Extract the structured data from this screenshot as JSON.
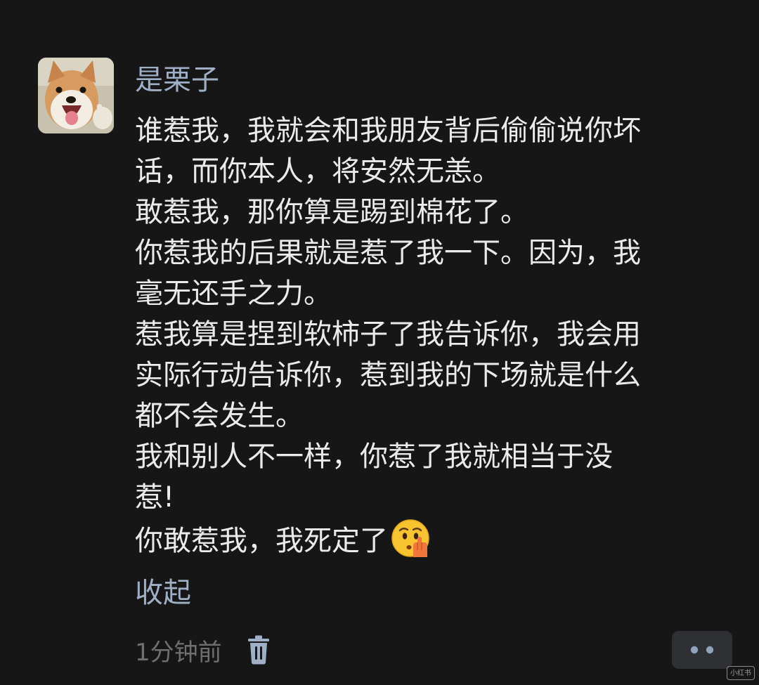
{
  "comment": {
    "author": "是栗子",
    "avatar_icon": "shiba-dog-avatar",
    "lines": [
      "谁惹我，我就会和我朋友背后偷偷说你坏",
      "话，而你本人，将安然无恙。",
      "敢惹我，那你算是踢到棉花了。",
      "你惹我的后果就是惹了我一下。因为，我",
      "毫无还手之力。",
      "惹我算是捏到软柿子了我告诉你，我会用",
      "实际行动告诉你，惹到我的下场就是什么",
      "都不会发生。",
      "我和别人不一样，你惹了我就相当于没",
      "惹!",
      "你敢惹我，我死定了"
    ],
    "last_line_emoji": "shushing-face-emoji",
    "collapse_label": "收起",
    "timestamp": "1分钟前",
    "watermark": "小红书"
  },
  "colors": {
    "background": "#161616",
    "text": "#ebebeb",
    "accent": "#9fb0c6",
    "meta": "#6f6f6f",
    "button_bg": "#2f3033"
  }
}
